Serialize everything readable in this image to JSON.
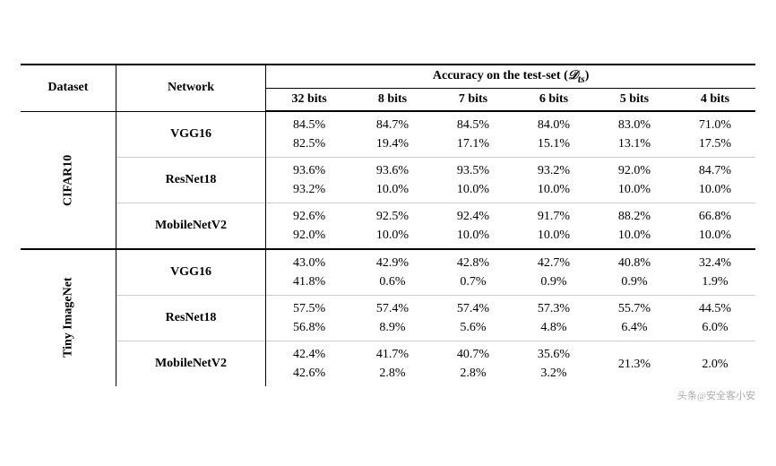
{
  "table": {
    "headers": {
      "dataset": "Dataset",
      "network": "Network",
      "accuracy": "Accuracy on the test-set",
      "accuracy_sub": "(D_ts)",
      "bits": [
        "32 bits",
        "8 bits",
        "7 bits",
        "6 bits",
        "5 bits",
        "4 bits"
      ]
    },
    "sections": [
      {
        "dataset": "CIFAR10",
        "rows": [
          {
            "network": "VGG16",
            "values": [
              {
                "top": "84.5%",
                "bottom": "82.5%"
              },
              {
                "top": "84.7%",
                "bottom": "19.4%"
              },
              {
                "top": "84.5%",
                "bottom": "17.1%"
              },
              {
                "top": "84.0%",
                "bottom": "15.1%"
              },
              {
                "top": "83.0%",
                "bottom": "13.1%"
              },
              {
                "top": "71.0%",
                "bottom": "17.5%"
              }
            ]
          },
          {
            "network": "ResNet18",
            "values": [
              {
                "top": "93.6%",
                "bottom": "93.2%"
              },
              {
                "top": "93.6%",
                "bottom": "10.0%"
              },
              {
                "top": "93.5%",
                "bottom": "10.0%"
              },
              {
                "top": "93.2%",
                "bottom": "10.0%"
              },
              {
                "top": "92.0%",
                "bottom": "10.0%"
              },
              {
                "top": "84.7%",
                "bottom": "10.0%"
              }
            ]
          },
          {
            "network": "MobileNetV2",
            "values": [
              {
                "top": "92.6%",
                "bottom": "92.0%"
              },
              {
                "top": "92.5%",
                "bottom": "10.0%"
              },
              {
                "top": "92.4%",
                "bottom": "10.0%"
              },
              {
                "top": "91.7%",
                "bottom": "10.0%"
              },
              {
                "top": "88.2%",
                "bottom": "10.0%"
              },
              {
                "top": "66.8%",
                "bottom": "10.0%"
              }
            ]
          }
        ]
      },
      {
        "dataset": "Tiny ImageNet",
        "rows": [
          {
            "network": "VGG16",
            "values": [
              {
                "top": "43.0%",
                "bottom": "41.8%"
              },
              {
                "top": "42.9%",
                "bottom": "0.6%"
              },
              {
                "top": "42.8%",
                "bottom": "0.7%"
              },
              {
                "top": "42.7%",
                "bottom": "0.9%"
              },
              {
                "top": "40.8%",
                "bottom": "0.9%"
              },
              {
                "top": "32.4%",
                "bottom": "1.9%"
              }
            ]
          },
          {
            "network": "ResNet18",
            "values": [
              {
                "top": "57.5%",
                "bottom": "56.8%"
              },
              {
                "top": "57.4%",
                "bottom": "8.9%"
              },
              {
                "top": "57.4%",
                "bottom": "5.6%"
              },
              {
                "top": "57.3%",
                "bottom": "4.8%"
              },
              {
                "top": "55.7%",
                "bottom": "6.4%"
              },
              {
                "top": "44.5%",
                "bottom": "6.0%"
              }
            ]
          },
          {
            "network": "MobileNetV2",
            "values": [
              {
                "top": "42.4%",
                "bottom": "42.6%"
              },
              {
                "top": "41.7%",
                "bottom": "2.8%"
              },
              {
                "top": "40.7%",
                "bottom": "2.8%"
              },
              {
                "top": "35.6%",
                "bottom": "3.2%"
              },
              {
                "top": "21.3%",
                "bottom": ""
              },
              {
                "top": "2.0%",
                "bottom": ""
              }
            ]
          }
        ]
      }
    ]
  },
  "watermark": "头条@安全客小安"
}
